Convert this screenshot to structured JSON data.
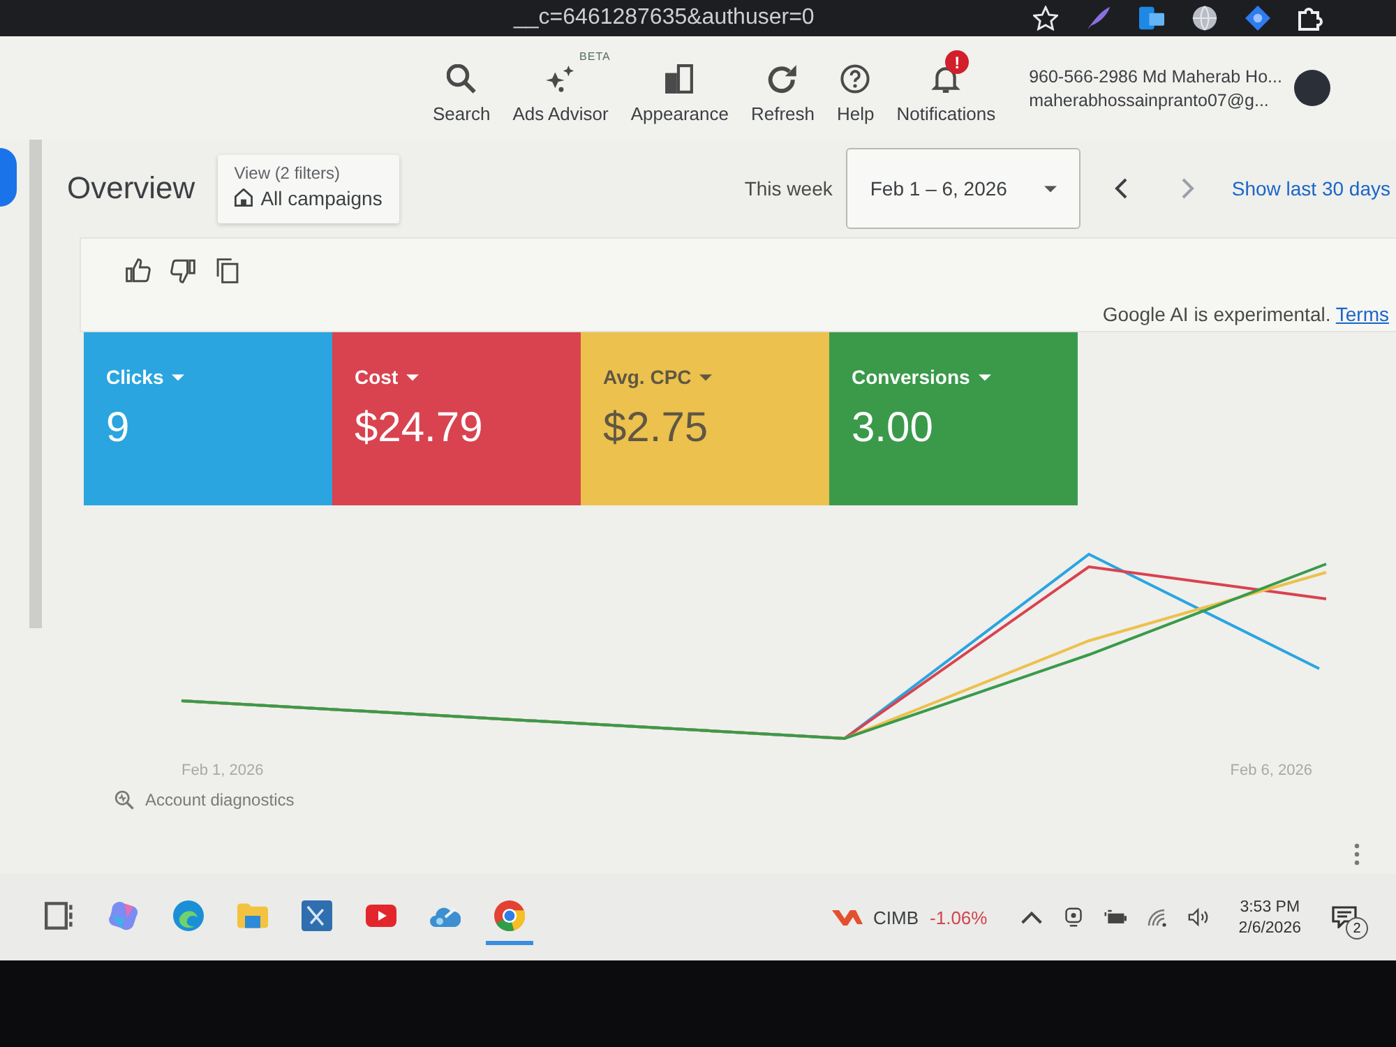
{
  "browser": {
    "url": "__c=6461287635&authuser=0"
  },
  "toolbar": {
    "items": [
      {
        "label": "Search",
        "kind": "search"
      },
      {
        "label": "Ads Advisor",
        "kind": "advisor",
        "badge": "BETA"
      },
      {
        "label": "Appearance",
        "kind": "appearance"
      },
      {
        "label": "Refresh",
        "kind": "refresh"
      },
      {
        "label": "Help",
        "kind": "help"
      },
      {
        "label": "Notifications",
        "kind": "notifications",
        "alert": "!"
      }
    ]
  },
  "account": {
    "name": "960-566-2986 Md Maherab Ho...",
    "email": "maherabhossainpranto07@g..."
  },
  "page": {
    "title": "Overview",
    "filter": {
      "caption": "View (2 filters)",
      "value": "All campaigns"
    }
  },
  "date_range": {
    "label": "This week",
    "value": "Feb 1 – 6, 2026",
    "link": "Show last 30 days"
  },
  "ai_feedback": {
    "note": "Google AI is experimental.",
    "link": "Terms"
  },
  "metrics": [
    {
      "name": "Clicks",
      "value": "9",
      "color": "#2aa5e0"
    },
    {
      "name": "Cost",
      "value": "$24.79",
      "color": "#d8434f"
    },
    {
      "name": "Avg. CPC",
      "value": "$2.75",
      "color": "#ecc14d"
    },
    {
      "name": "Conversions",
      "value": "3.00",
      "color": "#3a9a4a"
    }
  ],
  "chart": {
    "x_start": "Feb 1, 2026",
    "x_end": "Feb 6, 2026"
  },
  "diagnostics": {
    "label": "Account diagnostics"
  },
  "taskbar": {
    "apps": [
      {
        "kind": "task_view",
        "selected": false
      },
      {
        "kind": "assistant",
        "selected": false
      },
      {
        "kind": "wave_browser",
        "selected": false
      },
      {
        "kind": "folder",
        "selected": false
      },
      {
        "kind": "pen_tile",
        "selected": false
      },
      {
        "kind": "video",
        "selected": false
      },
      {
        "kind": "cloud",
        "selected": false
      },
      {
        "kind": "ring_browser",
        "selected": true
      }
    ],
    "stock": {
      "name": "CIMB",
      "change": "-1.06%"
    },
    "time": "3:53 PM",
    "date": "2/6/2026",
    "notification_count": "2"
  }
}
